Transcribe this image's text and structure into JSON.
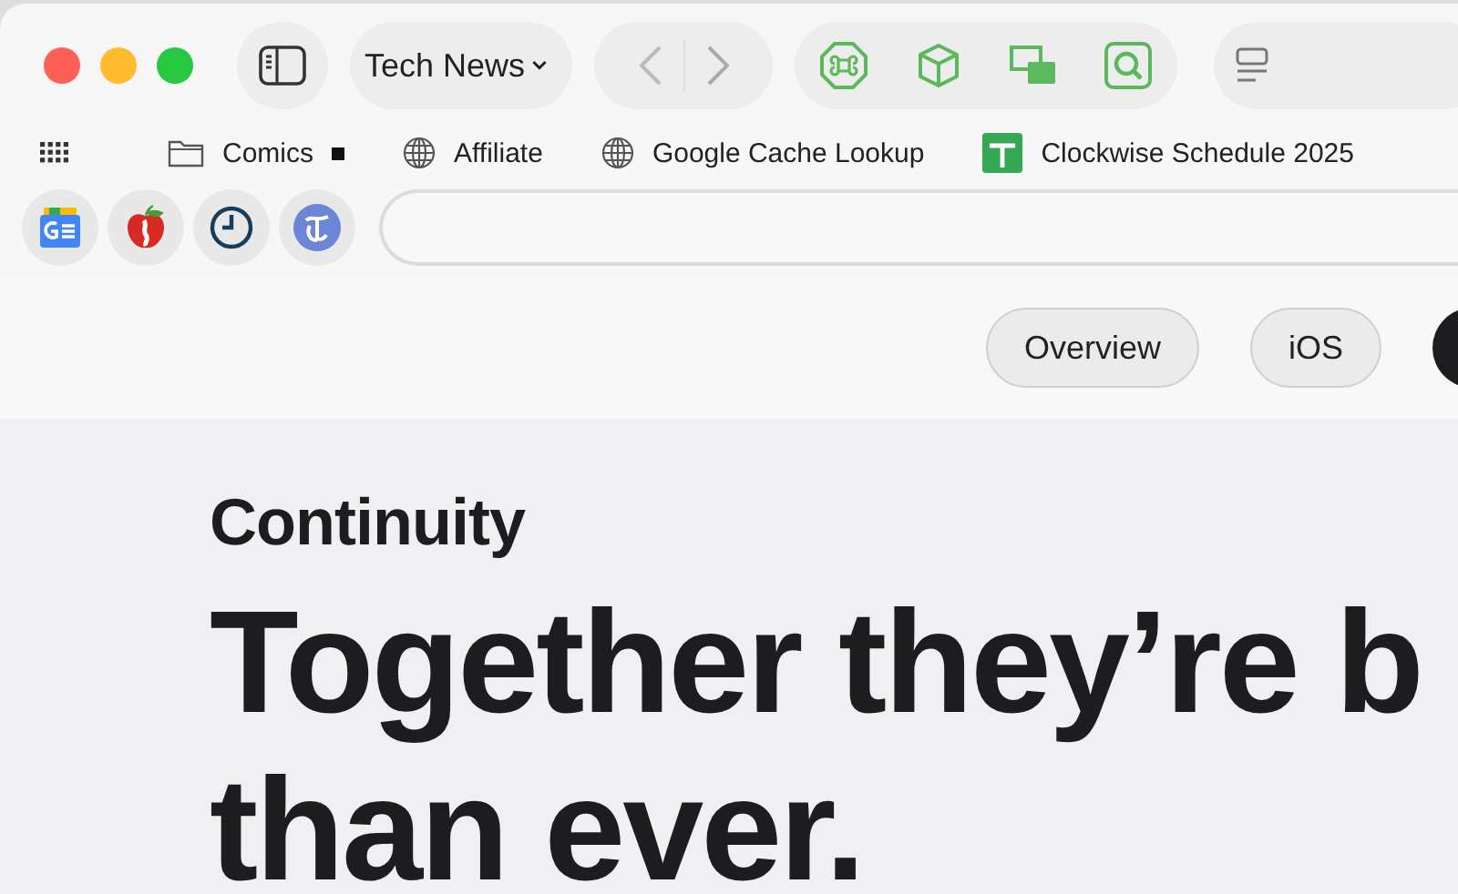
{
  "tab_group": {
    "label": "Tech News"
  },
  "extensions": [
    {
      "kind": "command"
    },
    {
      "kind": "cube"
    },
    {
      "kind": "pip"
    },
    {
      "kind": "search"
    }
  ],
  "bookmarks": [
    {
      "kind": "folder",
      "label": "Comics"
    },
    {
      "kind": "globe",
      "label": "Affiliate"
    },
    {
      "kind": "globe",
      "label": "Google Cache Lookup"
    },
    {
      "kind": "sheet",
      "label": "Clockwise Schedule 2025"
    }
  ],
  "favorites": [
    {
      "kind": "news"
    },
    {
      "kind": "apple"
    },
    {
      "kind": "clock"
    },
    {
      "kind": "times"
    }
  ],
  "page_nav": [
    {
      "label": "Overview"
    },
    {
      "label": "iOS"
    }
  ],
  "content": {
    "eyebrow": "Continuity",
    "headline": [
      "Together they’re b",
      "than ever."
    ]
  }
}
